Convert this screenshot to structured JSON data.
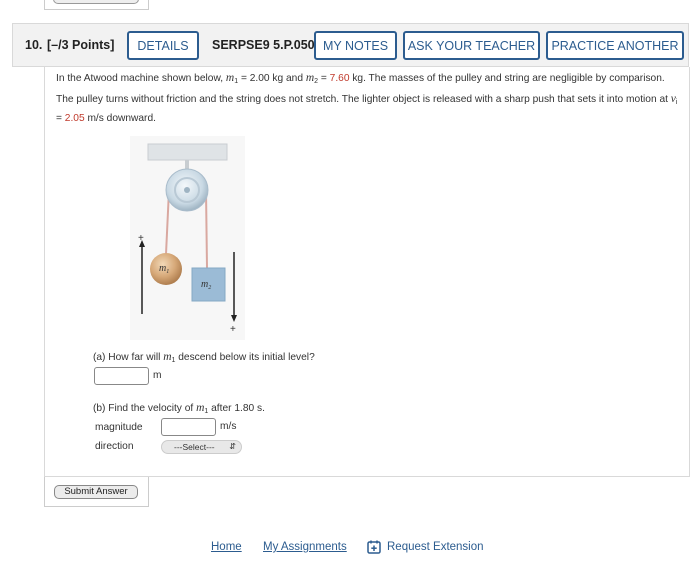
{
  "question": {
    "number": "10.",
    "points": "[–/3 Points]",
    "code": "SERPSE9 5.P.050."
  },
  "header_buttons": {
    "details": "DETAILS",
    "my_notes": "MY NOTES",
    "ask_teacher": "ASK YOUR TEACHER",
    "practice_another": "PRACTICE ANOTHER"
  },
  "problem": {
    "t1": "In the Atwood machine shown below, ",
    "m1_sym": "m",
    "m1_sub": "1",
    "t2": " = 2.00 kg and ",
    "m2_sym": "m",
    "m2_sub": "2",
    "t3": " = ",
    "m2_value": "7.60",
    "t4": " kg. The masses of the pulley and string are negligible by comparison. The pulley turns without friction and the string does not stretch. The lighter object is released with a sharp push that sets it into motion at ",
    "v_sym": "v",
    "v_sub": "i",
    "t5": " = ",
    "v_value": "2.05",
    "t6": " m/s downward."
  },
  "figure": {
    "m1_label": "m",
    "m1_sub": "1",
    "m2_label": "m",
    "m2_sub": "2",
    "plus": "+"
  },
  "part_a": {
    "q1": "(a) How far will ",
    "sym": "m",
    "sub": "1",
    "q2": " descend below its initial level?",
    "value": "",
    "unit": "m"
  },
  "part_b": {
    "q1": "(b) Find the velocity of ",
    "sym": "m",
    "sub": "1",
    "q2": " after 1.80 s.",
    "magnitude_label": "magnitude",
    "magnitude_value": "",
    "magnitude_unit": "m/s",
    "direction_label": "direction",
    "direction_selected": "---Select---"
  },
  "submit_label": "Submit Answer",
  "footer": {
    "home": "Home",
    "my_assignments": "My Assignments",
    "request_extension": "Request Extension"
  },
  "colors": {
    "accent": "#2c5c8f",
    "highlight_red": "#c0392b"
  }
}
